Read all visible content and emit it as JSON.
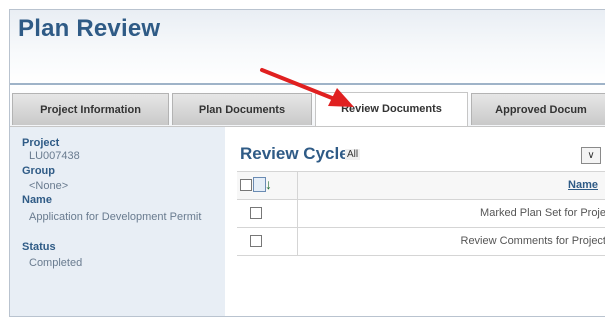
{
  "page": {
    "title": "Plan Review"
  },
  "tabs": [
    {
      "label": "Project Information",
      "active": false
    },
    {
      "label": "Plan Documents",
      "active": false
    },
    {
      "label": "Review Documents",
      "active": true
    },
    {
      "label": "Approved Docum",
      "active": false
    }
  ],
  "sidebar": {
    "project_label": "Project",
    "project_value": "LU007438",
    "group_label": "Group",
    "group_value": "<None>",
    "name_label": "Name",
    "name_value": "Application for Development Permit",
    "status_label": "Status",
    "status_value": "Completed"
  },
  "review": {
    "title": "Review Cycle",
    "filter_value": "All",
    "dropdown_icon": "chevron-down-icon",
    "column_name": "Name",
    "rows": [
      {
        "name": "Marked Plan Set for Proje"
      },
      {
        "name": "Review Comments for Project"
      }
    ]
  },
  "annotation": {
    "arrow_color": "#e02020",
    "target": "Review Documents"
  },
  "colors": {
    "title": "#2f5b86",
    "sidebar_bg": "#e8eef5",
    "accent_arrow": "#e02020"
  }
}
